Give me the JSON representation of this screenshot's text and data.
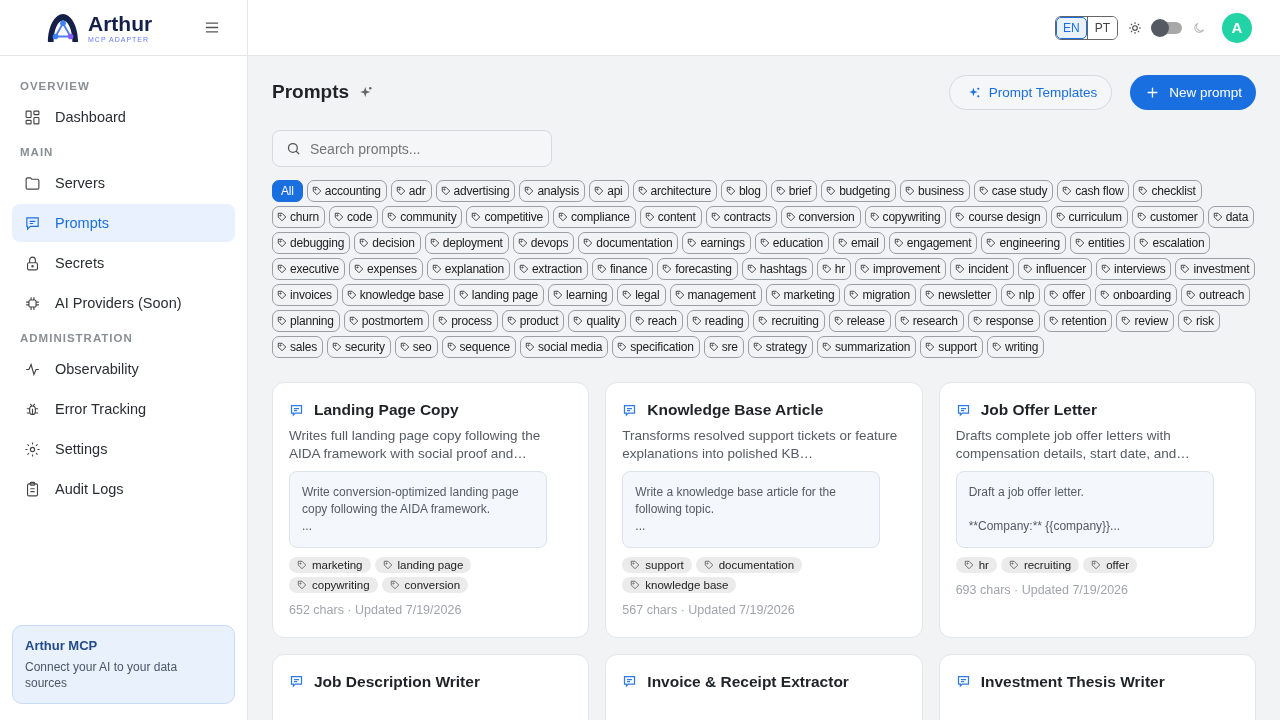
{
  "brand": {
    "name": "Arthur",
    "subtitle": "MCP ADAPTER"
  },
  "sidebar": {
    "sections": [
      {
        "heading": "OVERVIEW",
        "items": [
          {
            "label": "Dashboard",
            "kind": "grid",
            "selected": false
          }
        ]
      },
      {
        "heading": "MAIN",
        "items": [
          {
            "label": "Servers",
            "kind": "folder",
            "selected": false
          },
          {
            "label": "Prompts",
            "kind": "chat",
            "selected": true
          },
          {
            "label": "Secrets",
            "kind": "lock",
            "selected": false
          },
          {
            "label": "AI Providers (Soon)",
            "kind": "chip",
            "selected": false
          }
        ]
      },
      {
        "heading": "ADMINISTRATION",
        "items": [
          {
            "label": "Observability",
            "kind": "pulse",
            "selected": false
          },
          {
            "label": "Error Tracking",
            "kind": "bug",
            "selected": false
          },
          {
            "label": "Settings",
            "kind": "gear",
            "selected": false
          },
          {
            "label": "Audit Logs",
            "kind": "clipboard",
            "selected": false
          }
        ]
      }
    ],
    "footer": {
      "title": "Arthur MCP",
      "text": "Connect your AI to your data sources"
    }
  },
  "topbar": {
    "languages": [
      {
        "label": "EN",
        "selected": true
      },
      {
        "label": "PT",
        "selected": false
      }
    ],
    "dark_mode": {
      "on": false
    },
    "avatar": "A"
  },
  "page": {
    "title": "Prompts",
    "templates_button": "Prompt Templates",
    "new_button": "New prompt",
    "search": {
      "placeholder": "Search prompts..."
    }
  },
  "filters": [
    {
      "label": "All",
      "selected": true
    },
    {
      "label": "accounting",
      "selected": false
    },
    {
      "label": "adr",
      "selected": false
    },
    {
      "label": "advertising",
      "selected": false
    },
    {
      "label": "analysis",
      "selected": false
    },
    {
      "label": "api",
      "selected": false
    },
    {
      "label": "architecture",
      "selected": false
    },
    {
      "label": "blog",
      "selected": false
    },
    {
      "label": "brief",
      "selected": false
    },
    {
      "label": "budgeting",
      "selected": false
    },
    {
      "label": "business",
      "selected": false
    },
    {
      "label": "case study",
      "selected": false
    },
    {
      "label": "cash flow",
      "selected": false
    },
    {
      "label": "checklist",
      "selected": false
    },
    {
      "label": "churn",
      "selected": false
    },
    {
      "label": "code",
      "selected": false
    },
    {
      "label": "community",
      "selected": false
    },
    {
      "label": "competitive",
      "selected": false
    },
    {
      "label": "compliance",
      "selected": false
    },
    {
      "label": "content",
      "selected": false
    },
    {
      "label": "contracts",
      "selected": false
    },
    {
      "label": "conversion",
      "selected": false
    },
    {
      "label": "copywriting",
      "selected": false
    },
    {
      "label": "course design",
      "selected": false
    },
    {
      "label": "curriculum",
      "selected": false
    },
    {
      "label": "customer",
      "selected": false
    },
    {
      "label": "data",
      "selected": false
    },
    {
      "label": "debugging",
      "selected": false
    },
    {
      "label": "decision",
      "selected": false
    },
    {
      "label": "deployment",
      "selected": false
    },
    {
      "label": "devops",
      "selected": false
    },
    {
      "label": "documentation",
      "selected": false
    },
    {
      "label": "earnings",
      "selected": false
    },
    {
      "label": "education",
      "selected": false
    },
    {
      "label": "email",
      "selected": false
    },
    {
      "label": "engagement",
      "selected": false
    },
    {
      "label": "engineering",
      "selected": false
    },
    {
      "label": "entities",
      "selected": false
    },
    {
      "label": "escalation",
      "selected": false
    },
    {
      "label": "executive",
      "selected": false
    },
    {
      "label": "expenses",
      "selected": false
    },
    {
      "label": "explanation",
      "selected": false
    },
    {
      "label": "extraction",
      "selected": false
    },
    {
      "label": "finance",
      "selected": false
    },
    {
      "label": "forecasting",
      "selected": false
    },
    {
      "label": "hashtags",
      "selected": false
    },
    {
      "label": "hr",
      "selected": false
    },
    {
      "label": "improvement",
      "selected": false
    },
    {
      "label": "incident",
      "selected": false
    },
    {
      "label": "influencer",
      "selected": false
    },
    {
      "label": "interviews",
      "selected": false
    },
    {
      "label": "investment",
      "selected": false
    },
    {
      "label": "invoices",
      "selected": false
    },
    {
      "label": "knowledge base",
      "selected": false
    },
    {
      "label": "landing page",
      "selected": false
    },
    {
      "label": "learning",
      "selected": false
    },
    {
      "label": "legal",
      "selected": false
    },
    {
      "label": "management",
      "selected": false
    },
    {
      "label": "marketing",
      "selected": false
    },
    {
      "label": "migration",
      "selected": false
    },
    {
      "label": "newsletter",
      "selected": false
    },
    {
      "label": "nlp",
      "selected": false
    },
    {
      "label": "offer",
      "selected": false
    },
    {
      "label": "onboarding",
      "selected": false
    },
    {
      "label": "outreach",
      "selected": false
    },
    {
      "label": "planning",
      "selected": false
    },
    {
      "label": "postmortem",
      "selected": false
    },
    {
      "label": "process",
      "selected": false
    },
    {
      "label": "product",
      "selected": false
    },
    {
      "label": "quality",
      "selected": false
    },
    {
      "label": "reach",
      "selected": false
    },
    {
      "label": "reading",
      "selected": false
    },
    {
      "label": "recruiting",
      "selected": false
    },
    {
      "label": "release",
      "selected": false
    },
    {
      "label": "research",
      "selected": false
    },
    {
      "label": "response",
      "selected": false
    },
    {
      "label": "retention",
      "selected": false
    },
    {
      "label": "review",
      "selected": false
    },
    {
      "label": "risk",
      "selected": false
    },
    {
      "label": "sales",
      "selected": false
    },
    {
      "label": "security",
      "selected": false
    },
    {
      "label": "seo",
      "selected": false
    },
    {
      "label": "sequence",
      "selected": false
    },
    {
      "label": "social media",
      "selected": false
    },
    {
      "label": "specification",
      "selected": false
    },
    {
      "label": "sre",
      "selected": false
    },
    {
      "label": "strategy",
      "selected": false
    },
    {
      "label": "summarization",
      "selected": false
    },
    {
      "label": "support",
      "selected": false
    },
    {
      "label": "writing",
      "selected": false
    }
  ],
  "prompts": [
    {
      "title": "Landing Page Copy",
      "description": "Writes full landing page copy following the AIDA framework with social proof and…",
      "preview": "Write conversion-optimized landing page copy following the AIDA framework.\n...",
      "tags": [
        "marketing",
        "landing page",
        "copywriting",
        "conversion"
      ],
      "meta": "652 chars · Updated 7/19/2026"
    },
    {
      "title": "Knowledge Base Article",
      "description": "Transforms resolved support tickets or feature explanations into polished KB…",
      "preview": "Write a knowledge base article for the following topic.\n...",
      "tags": [
        "support",
        "documentation",
        "knowledge base"
      ],
      "meta": "567 chars · Updated 7/19/2026"
    },
    {
      "title": "Job Offer Letter",
      "description": "Drafts complete job offer letters with compensation details, start date, and…",
      "preview": "Draft a job offer letter.\n\n**Company:** {{company}}...",
      "tags": [
        "hr",
        "recruiting",
        "offer"
      ],
      "meta": "693 chars · Updated 7/19/2026"
    },
    {
      "title": "Job Description Writer"
    },
    {
      "title": "Invoice & Receipt Extractor"
    },
    {
      "title": "Investment Thesis Writer"
    }
  ]
}
